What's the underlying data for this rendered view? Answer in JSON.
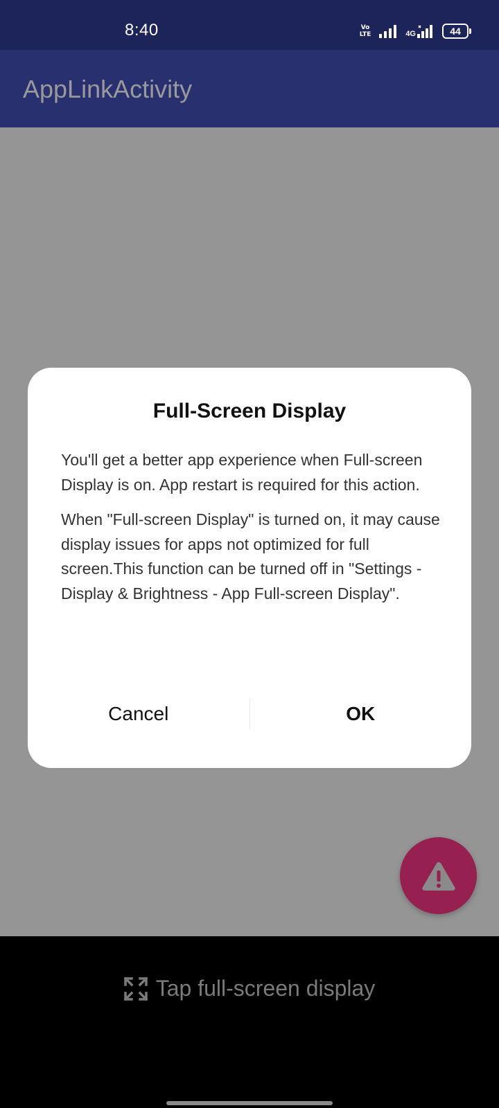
{
  "status_bar": {
    "time": "8:40",
    "volte_top": "Vo",
    "volte_bottom": "LTE",
    "network_label": "4G",
    "battery_level": "44",
    "icons": [
      "volte-icon",
      "signal-icon",
      "data-signal-icon",
      "battery-icon"
    ]
  },
  "app_bar": {
    "title": "AppLinkActivity"
  },
  "dialog": {
    "title": "Full-Screen Display",
    "paragraph_1": "You'll get a better app experience when Full-screen Display is on. App restart is required for this action.",
    "paragraph_2": "When \"Full-screen Display\" is turned on, it may cause display issues for apps not optimized for full screen.This function can be turned off in \"Settings - Display & Brightness - App Full-screen Display\".",
    "cancel_label": "Cancel",
    "ok_label": "OK"
  },
  "fab": {
    "icon": "warning-icon"
  },
  "bottom": {
    "fullscreen_prompt": "Tap full-screen display",
    "icon": "expand-icon"
  },
  "colors": {
    "status_bar": "#1c245a",
    "app_bar": "#283070",
    "scrim_background": "#959595",
    "fab": "#962050",
    "dialog": "#ffffff"
  }
}
